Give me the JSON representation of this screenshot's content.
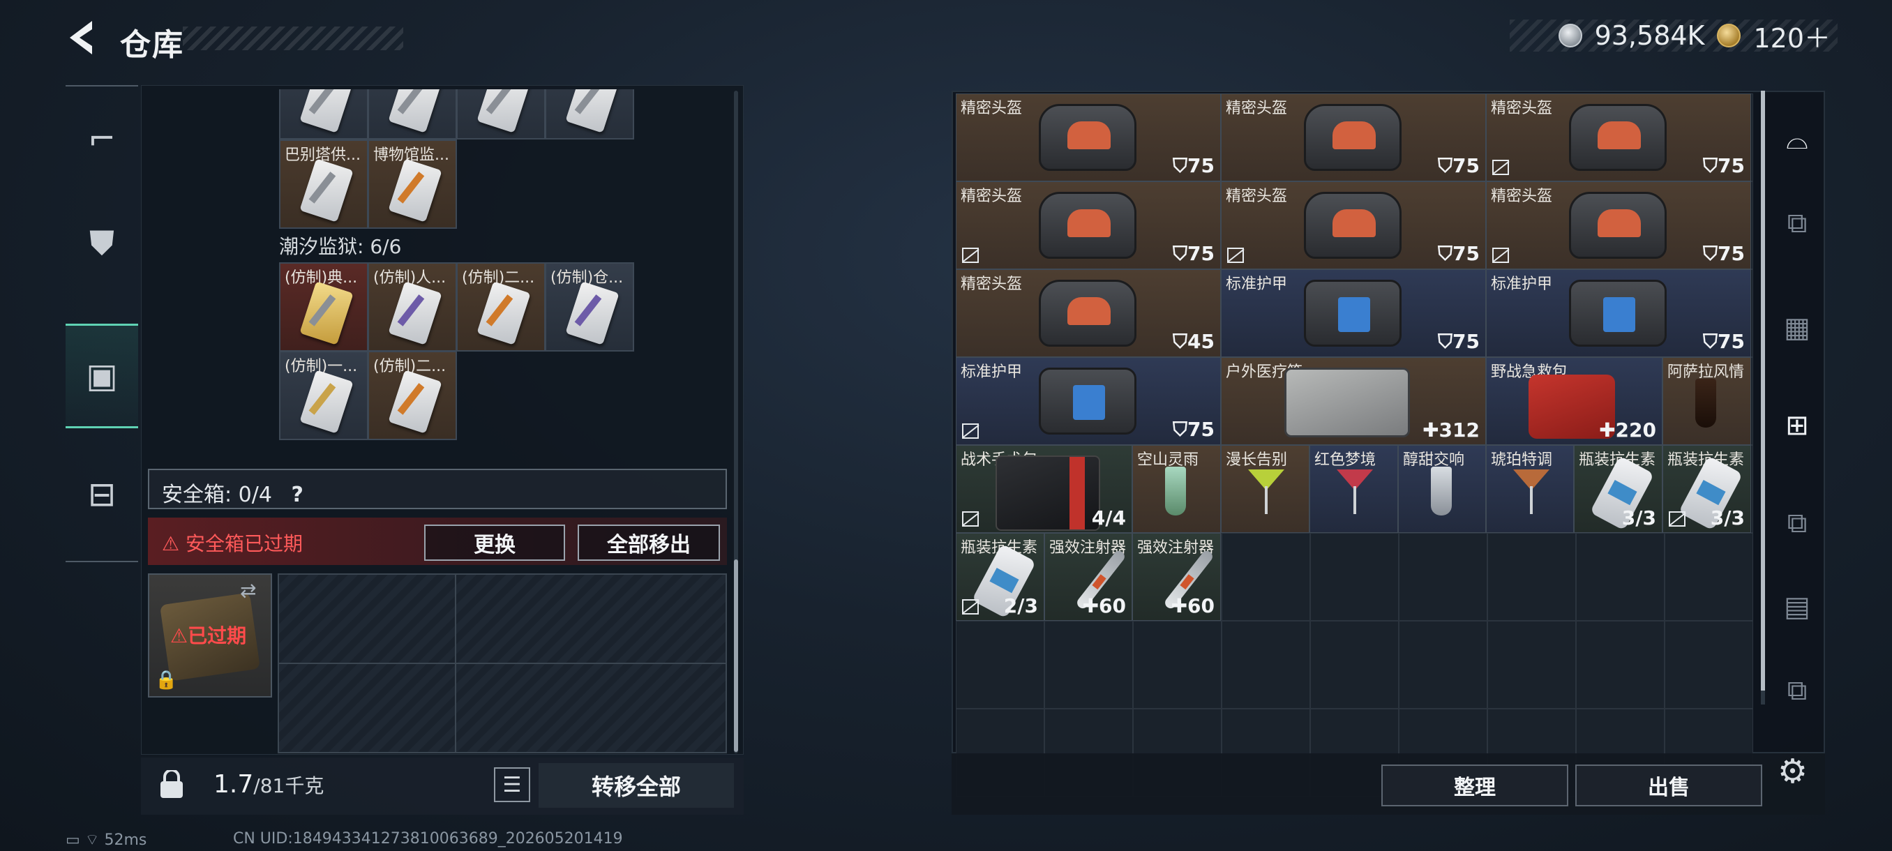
{
  "header": {
    "title": "仓库",
    "money": "93,584K",
    "tickets": "120＋"
  },
  "left_nav": {
    "items": [
      "weapon",
      "armor",
      "backpack",
      "case"
    ]
  },
  "stash_top": {
    "row1_labels": [
      "",
      "",
      "",
      ""
    ],
    "row2": [
      {
        "label": "巴别塔供..."
      },
      {
        "label": "博物馆监..."
      }
    ]
  },
  "section": {
    "prison": "潮汐监狱: 6/6"
  },
  "prison_items": [
    {
      "label": "(仿制)典..."
    },
    {
      "label": "(仿制)人..."
    },
    {
      "label": "(仿制)二..."
    },
    {
      "label": "(仿制)仓..."
    },
    {
      "label": "(仿制)一..."
    },
    {
      "label": "(仿制)二..."
    }
  ],
  "safebox": {
    "label": "安全箱: 0/4",
    "help": "?",
    "expired_warning": "安全箱已过期",
    "replace": "更换",
    "move_out_all": "全部移出",
    "expired_badge": "已过期"
  },
  "footer_left": {
    "weight": "1.7",
    "weight_cap": "/81千克",
    "move_all": "转移全部"
  },
  "status": {
    "ping": "52ms",
    "uid": "CN UID:1849433412738100636​89_202605201419"
  },
  "items": [
    {
      "name": "精密头盔",
      "value": "75",
      "lock": false
    },
    {
      "name": "精密头盔",
      "value": "75",
      "lock": false
    },
    {
      "name": "精密头盔",
      "value": "75",
      "lock": true
    },
    {
      "name": "精密头盔",
      "value": "75",
      "lock": true
    },
    {
      "name": "精密头盔",
      "value": "75",
      "lock": true
    },
    {
      "name": "精密头盔",
      "value": "75",
      "lock": true
    },
    {
      "name": "精密头盔",
      "value": "45",
      "lock": false
    },
    {
      "name": "标准护甲",
      "value": "75",
      "lock": false
    },
    {
      "name": "标准护甲",
      "value": "75",
      "lock": false
    },
    {
      "name": "标准护甲",
      "value": "75",
      "lock": true
    },
    {
      "name": "户外医疗箱",
      "value": "312"
    },
    {
      "name": "野战急救包",
      "value": "220"
    },
    {
      "name": "阿萨拉风情"
    },
    {
      "name": "战术手术包",
      "value": "4/4",
      "lock": true
    },
    {
      "name": "空山灵雨"
    },
    {
      "name": "漫长告别"
    },
    {
      "name": "红色梦境"
    },
    {
      "name": "醇甜交响"
    },
    {
      "name": "琥珀特调"
    },
    {
      "name": "瓶装抗生素",
      "value": "3/3"
    },
    {
      "name": "瓶装抗生素",
      "value": "3/3",
      "lock": true
    },
    {
      "name": "瓶装抗生素",
      "value": "2/3",
      "lock": true
    },
    {
      "name": "强效注射器",
      "value": "60"
    },
    {
      "name": "强效注射器",
      "value": "60"
    }
  ],
  "footer_right": {
    "sort": "整理",
    "sell": "出售"
  },
  "colors": {
    "accent": "#5fd2b3",
    "warning": "#ff5a5a"
  }
}
